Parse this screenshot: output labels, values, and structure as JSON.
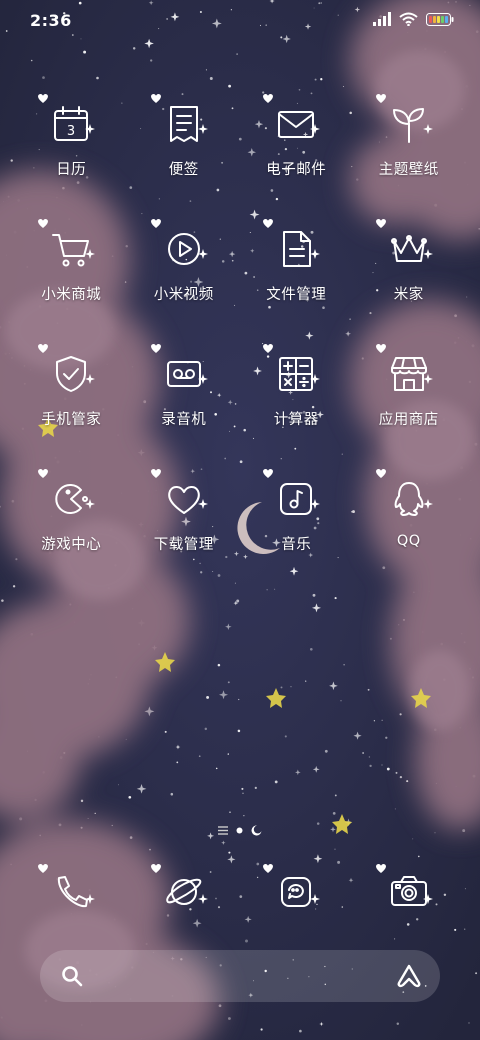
{
  "status_bar": {
    "time": "2:36"
  },
  "apps": [
    [
      {
        "label": "日历",
        "icon": "calendar-icon",
        "day": "3"
      },
      {
        "label": "便签",
        "icon": "notes-icon"
      },
      {
        "label": "电子邮件",
        "icon": "mail-icon"
      },
      {
        "label": "主题壁纸",
        "icon": "sprout-icon"
      }
    ],
    [
      {
        "label": "小米商城",
        "icon": "shopping-cart-icon"
      },
      {
        "label": "小米视频",
        "icon": "play-icon"
      },
      {
        "label": "文件管理",
        "icon": "file-icon"
      },
      {
        "label": "米家",
        "icon": "crown-icon"
      }
    ],
    [
      {
        "label": "手机管家",
        "icon": "shield-icon"
      },
      {
        "label": "录音机",
        "icon": "recorder-icon"
      },
      {
        "label": "计算器",
        "icon": "calculator-icon"
      },
      {
        "label": "应用商店",
        "icon": "store-icon"
      }
    ],
    [
      {
        "label": "游戏中心",
        "icon": "pacman-icon"
      },
      {
        "label": "下载管理",
        "icon": "heart-icon"
      },
      {
        "label": "音乐",
        "icon": "music-note-icon"
      },
      {
        "label": "QQ",
        "icon": "penguin-icon"
      }
    ]
  ],
  "dock": [
    {
      "name": "phone",
      "icon": "phone-icon"
    },
    {
      "name": "browser",
      "icon": "planet-icon"
    },
    {
      "name": "messages",
      "icon": "message-icon"
    },
    {
      "name": "camera",
      "icon": "camera-icon"
    }
  ],
  "colors": {
    "sky": "#2a2c45",
    "cloud": "#8d6d7d",
    "star_yellow": "#e7d54a",
    "icon_stroke": "#ffffff"
  }
}
